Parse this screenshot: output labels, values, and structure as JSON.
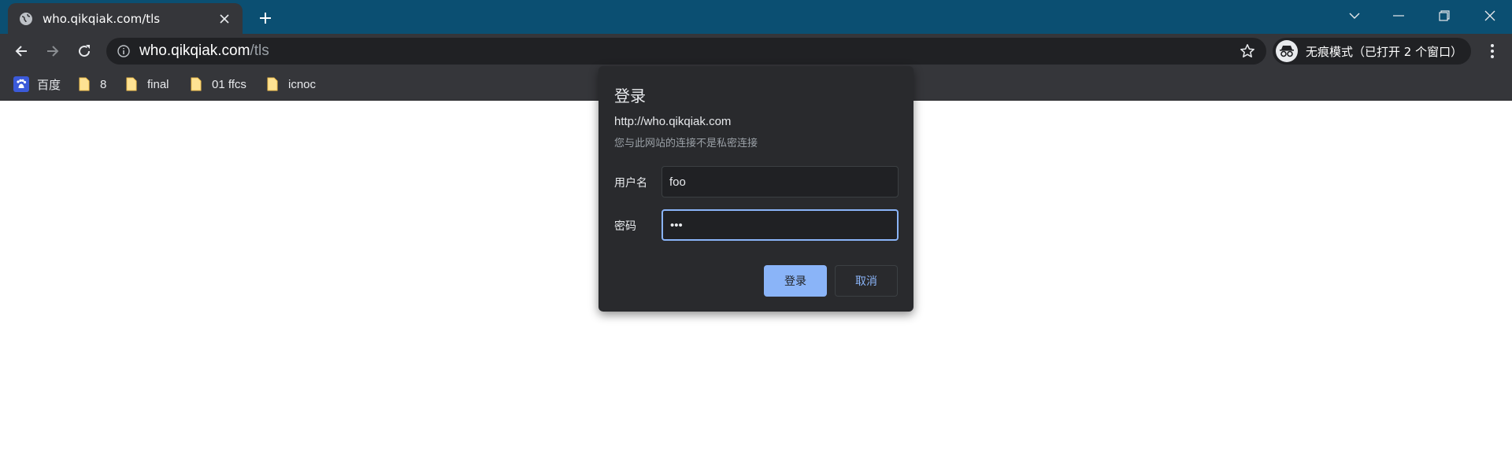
{
  "tab": {
    "title": "who.qikqiak.com/tls",
    "icon": "globe-icon"
  },
  "address_bar": {
    "host": "who.qikqiak.com",
    "path": "/tls"
  },
  "incognito": {
    "label": "无痕模式（已打开 2 个窗口）"
  },
  "bookmarks": [
    {
      "label": "百度",
      "icon": "baidu-icon"
    },
    {
      "label": "8",
      "icon": "folder-icon"
    },
    {
      "label": "final",
      "icon": "folder-icon"
    },
    {
      "label": "01 ffcs",
      "icon": "folder-icon"
    },
    {
      "label": "icnoc",
      "icon": "folder-icon"
    }
  ],
  "dialog": {
    "title": "登录",
    "site": "http://who.qikqiak.com",
    "warning": "您与此网站的连接不是私密连接",
    "username_label": "用户名",
    "username_value": "foo",
    "password_label": "密码",
    "password_value": "•••",
    "ok_label": "登录",
    "cancel_label": "取消"
  },
  "colors": {
    "titlebar": "#0b4f72",
    "toolbar": "#35363a",
    "accent": "#8ab4f8"
  }
}
